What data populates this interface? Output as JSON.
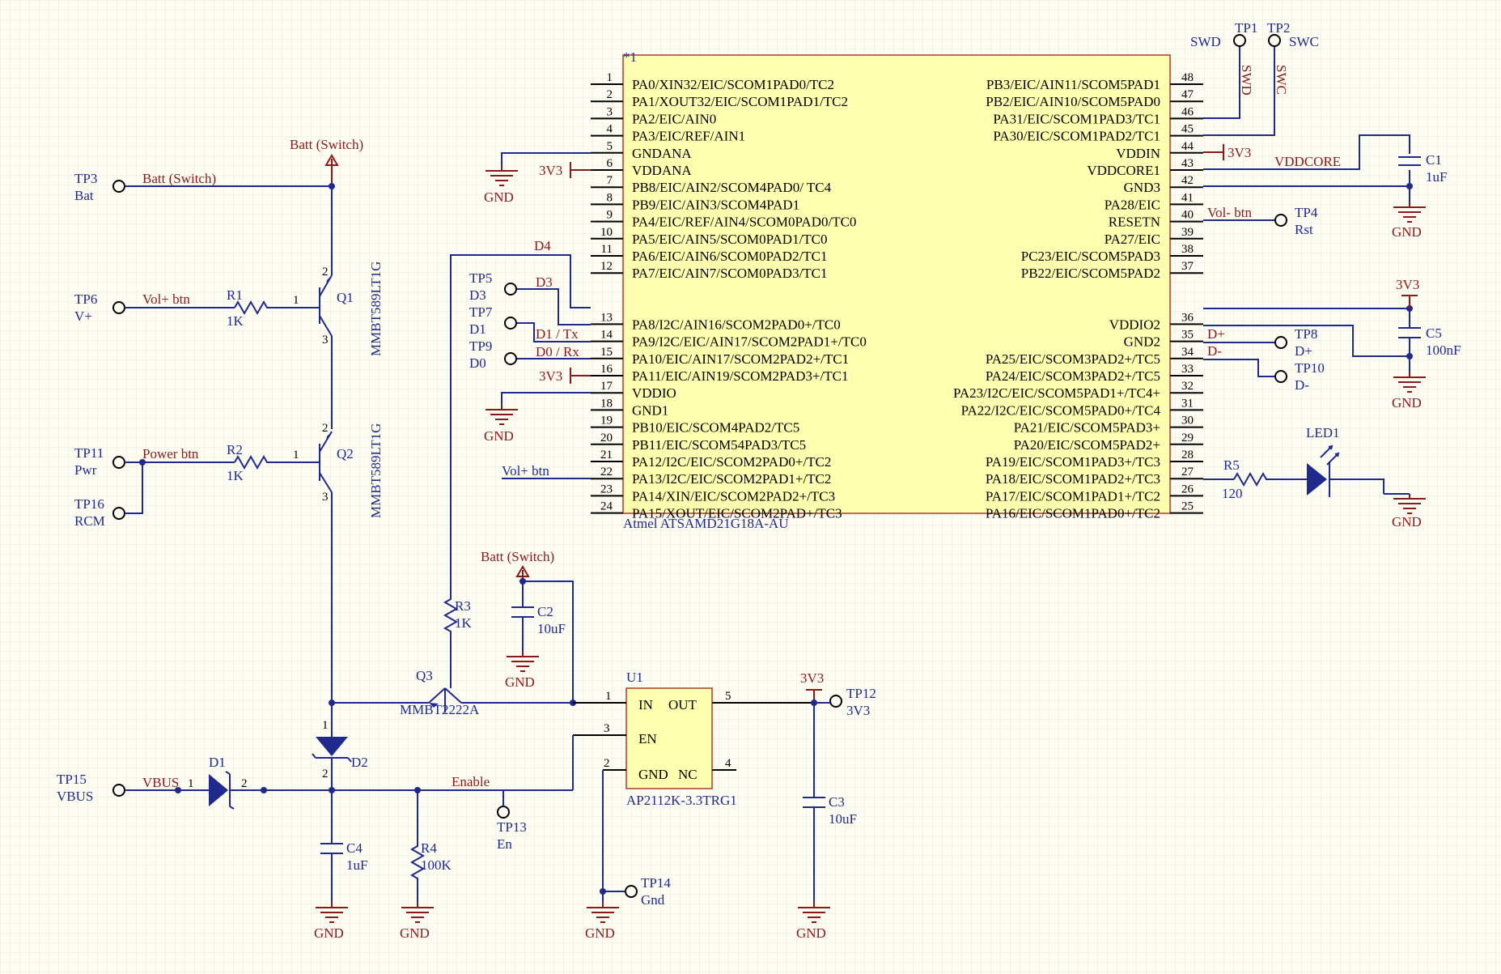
{
  "mcu": {
    "designator": "*1",
    "part": "Atmel ATSAMD21G18A-AU",
    "left_pins": [
      {
        "num": "1",
        "name": "PA0/XIN32/EIC/SCOM1PAD0/TC2"
      },
      {
        "num": "2",
        "name": "PA1/XOUT32/EIC/SCOM1PAD1/TC2"
      },
      {
        "num": "3",
        "name": "PA2/EIC/AIN0"
      },
      {
        "num": "4",
        "name": "PA3/EIC/REF/AIN1"
      },
      {
        "num": "5",
        "name": "GNDANA"
      },
      {
        "num": "6",
        "name": "VDDANA"
      },
      {
        "num": "7",
        "name": "PB8/EIC/AIN2/SCOM4PAD0/ TC4"
      },
      {
        "num": "8",
        "name": "PB9/EIC/AIN3/SCOM4PAD1"
      },
      {
        "num": "9",
        "name": "PA4/EIC/REF/AIN4/SCOM0PAD0/TC0"
      },
      {
        "num": "10",
        "name": "PA5/EIC/AIN5/SCOM0PAD1/TC0"
      },
      {
        "num": "11",
        "name": "PA6/EIC/AIN6/SCOM0PAD2/TC1"
      },
      {
        "num": "12",
        "name": "PA7/EIC/AIN7/SCOM0PAD3/TC1"
      },
      {
        "num": "13",
        "name": "PA8/I2C/AIN16/SCOM2PAD0+/TC0"
      },
      {
        "num": "14",
        "name": "PA9/I2C/EIC/AIN17/SCOM2PAD1+/TC0"
      },
      {
        "num": "15",
        "name": "PA10/EIC/AIN17/SCOM2PAD2+/TC1"
      },
      {
        "num": "16",
        "name": "PA11/EIC/AIN19/SCOM2PAD3+/TC1"
      },
      {
        "num": "17",
        "name": "VDDIO"
      },
      {
        "num": "18",
        "name": "GND1"
      },
      {
        "num": "19",
        "name": "PB10/EIC/SCOM4PAD2/TC5"
      },
      {
        "num": "20",
        "name": "PB11/EIC/SCOM54PAD3/TC5"
      },
      {
        "num": "21",
        "name": "PA12/I2C/EIC/SCOM2PAD0+/TC2"
      },
      {
        "num": "22",
        "name": "PA13/I2C/EIC/SCOM2PAD1+/TC2"
      },
      {
        "num": "23",
        "name": "PA14/XIN/EIC/SCOM2PAD2+/TC3"
      },
      {
        "num": "24",
        "name": "PA15/XOUT/EIC/SCOM2PAD+/TC3"
      }
    ],
    "right_pins": [
      {
        "num": "48",
        "name": "PB3/EIC/AIN11/SCOM5PAD1"
      },
      {
        "num": "47",
        "name": "PB2/EIC/AIN10/SCOM5PAD0"
      },
      {
        "num": "46",
        "name": "PA31/EIC/SCOM1PAD3/TC1"
      },
      {
        "num": "45",
        "name": "PA30/EIC/SCOM1PAD2/TC1"
      },
      {
        "num": "44",
        "name": "VDDIN"
      },
      {
        "num": "43",
        "name": "VDDCORE1"
      },
      {
        "num": "42",
        "name": "GND3"
      },
      {
        "num": "41",
        "name": "PA28/EIC"
      },
      {
        "num": "40",
        "name": "RESETN"
      },
      {
        "num": "39",
        "name": "PA27/EIC"
      },
      {
        "num": "38",
        "name": "PC23/EIC/SCOM5PAD3"
      },
      {
        "num": "37",
        "name": "PB22/EIC/SCOM5PAD2"
      },
      {
        "num": "36",
        "name": "VDDIO2"
      },
      {
        "num": "35",
        "name": "GND2"
      },
      {
        "num": "34",
        "name": "PA25/EIC/SCOM3PAD2+/TC5"
      },
      {
        "num": "33",
        "name": "PA24/EIC/SCOM3PAD2+/TC5"
      },
      {
        "num": "32",
        "name": "PA23/I2C/EIC/SCOM5PAD1+/TC4+"
      },
      {
        "num": "31",
        "name": "PA22/I2C/EIC/SCOM5PAD0+/TC4"
      },
      {
        "num": "30",
        "name": "PA21/EIC/SCOM5PAD3+"
      },
      {
        "num": "29",
        "name": "PA20/EIC/SCOM5PAD2+"
      },
      {
        "num": "28",
        "name": "PA19/EIC/SCOM1PAD3+/TC3"
      },
      {
        "num": "27",
        "name": "PA18/EIC/SCOM1PAD2+/TC3"
      },
      {
        "num": "26",
        "name": "PA17/EIC/SCOM1PAD1+/TC2"
      },
      {
        "num": "25",
        "name": "PA16/EIC/SCOM1PAD0+/TC2"
      }
    ]
  },
  "regulator": {
    "designator": "U1",
    "part": "AP2112K-3.3TRG1",
    "in": "IN",
    "out": "OUT",
    "en": "EN",
    "gnd": "GND",
    "nc": "NC",
    "p1": "1",
    "p2": "2",
    "p3": "3",
    "p4": "4",
    "p5": "5"
  },
  "transistors": {
    "q1": {
      "ref": "Q1",
      "part": "MMBT589LT1G"
    },
    "q2": {
      "ref": "Q2",
      "part": "MMBT589LT1G"
    },
    "q3": {
      "ref": "Q3",
      "part": "MMBT2222A"
    },
    "pin1": "1",
    "pin2": "2",
    "pin3": "3"
  },
  "resistors": {
    "r1": {
      "ref": "R1",
      "value": "1K"
    },
    "r2": {
      "ref": "R2",
      "value": "1K"
    },
    "r3": {
      "ref": "R3",
      "value": "1K"
    },
    "r4": {
      "ref": "R4",
      "value": "100K"
    },
    "r5": {
      "ref": "R5",
      "value": "120"
    }
  },
  "capacitors": {
    "c1": {
      "ref": "C1",
      "value": "1uF"
    },
    "c2": {
      "ref": "C2",
      "value": "10uF"
    },
    "c3": {
      "ref": "C3",
      "value": "10uF"
    },
    "c4": {
      "ref": "C4",
      "value": "1uF"
    },
    "c5": {
      "ref": "C5",
      "value": "100nF"
    }
  },
  "diodes": {
    "d1": {
      "ref": "D1",
      "p1": "1",
      "p2": "2"
    },
    "d2": {
      "ref": "D2",
      "p1": "1",
      "p2": "2"
    },
    "led1": {
      "ref": "LED1"
    }
  },
  "test_points": {
    "tp1": {
      "ref": "TP1",
      "net": "SWD"
    },
    "tp2": {
      "ref": "TP2",
      "net": "SWC"
    },
    "tp3": {
      "ref": "TP3",
      "net": "Bat"
    },
    "tp4": {
      "ref": "TP4",
      "net": "Rst"
    },
    "tp5": {
      "ref": "TP5",
      "net": "D3"
    },
    "tp6": {
      "ref": "TP6",
      "net": "V+"
    },
    "tp7": {
      "ref": "TP7",
      "net": "D1"
    },
    "tp8": {
      "ref": "TP8",
      "net": "D+"
    },
    "tp9": {
      "ref": "TP9",
      "net": "D0"
    },
    "tp10": {
      "ref": "TP10",
      "net": "D-"
    },
    "tp11": {
      "ref": "TP11",
      "net": "Pwr"
    },
    "tp12": {
      "ref": "TP12",
      "net": "3V3"
    },
    "tp13": {
      "ref": "TP13",
      "net": "En"
    },
    "tp14": {
      "ref": "TP14",
      "net": "Gnd"
    },
    "tp15": {
      "ref": "TP15",
      "net": "VBUS"
    },
    "tp16": {
      "ref": "TP16",
      "net": "RCM"
    }
  },
  "nets": {
    "batt_switch": "Batt (Switch)",
    "vol_plus": "Vol+ btn",
    "vol_minus": "Vol- btn",
    "power_btn": "Power btn",
    "vbus": "VBUS",
    "enable": "Enable",
    "d4": "D4",
    "d3": "D3",
    "d1_tx": "D1 / Tx",
    "d0_rx": "D0 / Rx",
    "d_plus": "D+",
    "d_minus": "D-",
    "swd": "SWD",
    "swc": "SWC",
    "vddcore": "VDDCORE",
    "v3v3": "3V3",
    "gnd": "GND"
  },
  "colors": {
    "background": "#fdfdf4",
    "wire": "#1f2a8c",
    "power_net": "#8a1a1a",
    "ic_body": "#ffffb0"
  }
}
